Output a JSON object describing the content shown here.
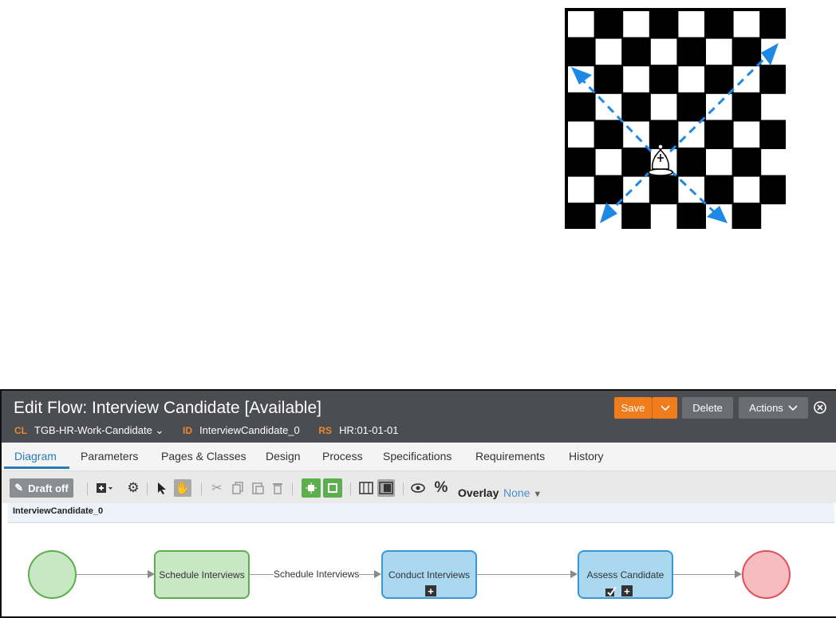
{
  "window": {
    "title": "Edit Flow: Interview Candidate [Available]",
    "meta": [
      {
        "key": "CL",
        "value": "TGB-HR-Work-Candidate"
      },
      {
        "key": "ID",
        "value": "InterviewCandidate_0"
      },
      {
        "key": "RS",
        "value": "HR:01-01-01"
      }
    ],
    "buttons": {
      "save": "Save",
      "delete": "Delete",
      "actions": "Actions"
    }
  },
  "tabs": [
    "Diagram",
    "Parameters",
    "Pages & Classes",
    "Design",
    "Process",
    "Specifications",
    "Requirements",
    "History"
  ],
  "toolbar": {
    "draft": "Draft off",
    "overlay_label": "Overlay",
    "overlay_value": "None"
  },
  "flow": {
    "name": "InterviewCandidate_0",
    "nodes": [
      "Schedule Interviews",
      "Conduct Interviews",
      "Assess Candidate"
    ],
    "connector_label": "Schedule Interviews"
  },
  "colors": {
    "accent": "#2a7ab8",
    "save": "#f07c1c",
    "header": "#4b4d52",
    "arrow": "#1e88e5"
  }
}
